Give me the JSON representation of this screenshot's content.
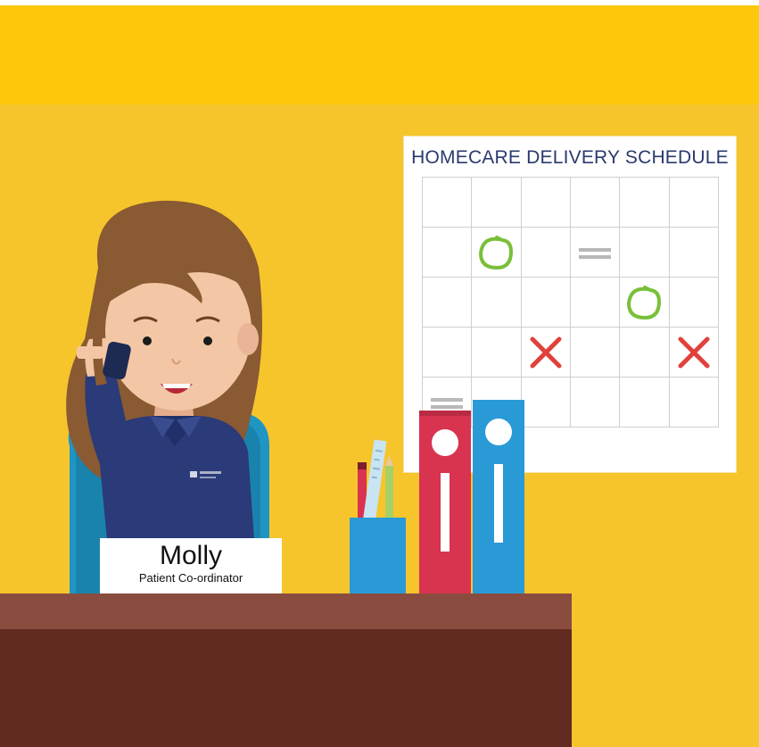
{
  "schedule_board": {
    "title": "HOMECARE DELIVERY SCHEDULE",
    "rows": 5,
    "columns": 6,
    "marks": [
      {
        "row": 1,
        "col": 1,
        "type": "circle"
      },
      {
        "row": 1,
        "col": 3,
        "type": "dash"
      },
      {
        "row": 2,
        "col": 4,
        "type": "circle"
      },
      {
        "row": 3,
        "col": 2,
        "type": "cross"
      },
      {
        "row": 3,
        "col": 5,
        "type": "cross"
      },
      {
        "row": 4,
        "col": 0,
        "type": "dash"
      }
    ]
  },
  "nameplate": {
    "name": "Molly",
    "role": "Patient Co-ordinator"
  },
  "colors": {
    "top_band": "#fdc70c",
    "wall": "#f6c52c",
    "desk_top": "#8a4c3e",
    "desk_front": "#612b20",
    "circle_mark": "#79bf3a",
    "cross_mark": "#e0413b",
    "dash_mark": "#b8b8b8",
    "binder_red": "#d8334f",
    "binder_blue": "#2a9ad6",
    "shirt": "#2b3a78",
    "hair": "#8a5a33",
    "skin": "#f3c7a5",
    "chair": "#1f95c4"
  },
  "icons": [
    "phone-icon",
    "pencil-holder-icon",
    "binder-icon"
  ]
}
